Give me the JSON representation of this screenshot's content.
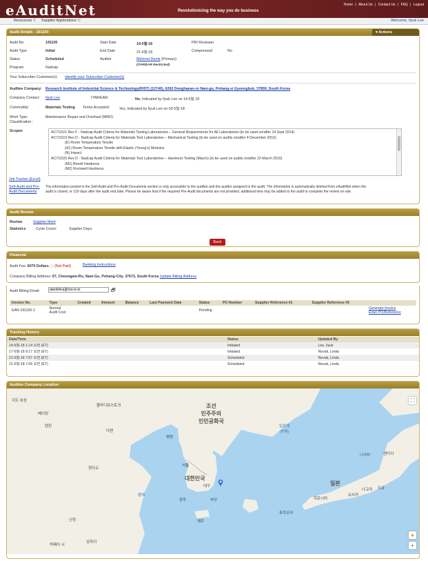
{
  "header": {
    "logo": "eAuditNet",
    "tagline": "Revolutionizing the way you do business",
    "links": [
      "Home",
      "About Us",
      "Contact Us",
      "FAQ",
      "Logout"
    ],
    "separator": "|"
  },
  "nav": {
    "menu1": "Resources",
    "menu2": "Supplier Applications",
    "arrow": "▽",
    "welcome": "Welcome, Ilyuk Lee"
  },
  "audit": {
    "title": "Audit Details - 191100",
    "actions": "Actions",
    "l_no": "Audit No.",
    "v_no": "191100",
    "l_type": "Audit Type",
    "v_type": "Initial",
    "l_status": "Status",
    "v_status": "Scheduled",
    "l_program": "Program",
    "v_program": "Nadcap",
    "l_start": "Start Date",
    "v_start": "19-5월-18",
    "l_end": "End Date",
    "v_end": "21-5월-18",
    "l_auditor": "Auditor",
    "v_auditor": "Mehmet Demir",
    "v_primary": "(Primary)",
    "v_itar": "(ITAR/EAR Restricted)",
    "l_pri": "PRI Reviewer",
    "l_comp": "Compressed",
    "v_comp": "No",
    "l_subcust": "Your Subscriber Customer(s):",
    "v_subcust": "Identify your Subscriber Customer(s)",
    "l_company": "Auditee Company:",
    "v_company": "Research Institute of Industrial Science & Technology(RIST) (12740), 6262 Donghaean-ro Nam-gu, Pohang-si Gyeongbuk, 37859, South Korea",
    "l_contact": "Company Contact:",
    "v_contact": "Ilyuk Lee",
    "l_itar": "ITAR/EAR:",
    "v_itar_no": "No",
    "v_itar_rest": ", Indicated by Ilyuk Lee on 14-5월-18",
    "l_commodity": "Commodity:",
    "v_commodity": "Materials Testing",
    "l_terms": "Terms Accepted:",
    "v_terms": "Yes, Indicated by Ilyuk Lee on 03-5월-18",
    "l_worktype": "Work Type:",
    "l_class": "Classification :",
    "v_worktype": "Maintenance Repair and Overhaul (MRO)",
    "l_scopes": "Scopes",
    "scopes": [
      {
        "t": "AC7101/1 Rev F - Nadcap Audit Criteria for Materials Testing Laboratories – General Requirements for All Laboratories (to be used on/after 14 Sept 2014)",
        "i": false
      },
      {
        "t": "AC7101/3 Rev D - Nadcap Audit Criteria for Materials Test Laboratories – Mechanical Testing (to be used on audits on/after 4 December 2016)",
        "i": false
      },
      {
        "t": "(E) Room Temperature Tensile",
        "i": true
      },
      {
        "t": "(A1) Room Temperature Tensile with Elastic (Young's) Modulus",
        "i": true
      },
      {
        "t": "(N) Impact",
        "i": true
      },
      {
        "t": "AC7101/5 Rev D - Nadcap Audit Criteria for Materials Test Laboratories – Hardness Testing (Macro) (to be used on audits on/after 22 March 2015)",
        "i": false
      },
      {
        "t": "(M1) Brinell Hardness",
        "i": true
      },
      {
        "t": "(M2) Rockwell Hardness",
        "i": true
      }
    ],
    "l_jobtracker": "Job Tracker (Excel)",
    "l_selfaudit1": "Self-Audit and Pre-",
    "l_selfaudit2": "Audit Documents",
    "notice1": "The information posted in the Self-Audit and Pre-Audit Documents section is only accessible to the auditee and the auditor assigned to the audit. The information is automatically deleted from eAuditNet when the",
    "notice2": "audit is closed, or 120 days after the audit end date. Please be aware that if the required Pre-Audit documents are not provided, additional time may be added to the audit to complete the review on-site."
  },
  "review": {
    "title": "Audit Review",
    "l_review": "Review",
    "v_review": "Supplier Merit",
    "l_stats": "Statistics",
    "l_cycle": "Cycle Count:",
    "l_days": "Supplier Days:",
    "back": "Back"
  },
  "financial": {
    "title": "Financial",
    "l_fee": "Audit Fee:",
    "v_fee": "6070 Dollars",
    "v_paid": "(Not Paid)",
    "v_bank": "Banking Instructions",
    "l_addr": "Company Billing Address:",
    "v_addr": "67, Cheongam-Ro, Nam-Gu, Pohang-City, 37673, South Korea",
    "v_update": "Update Billing Address",
    "l_email": "Audit Billing Email:",
    "v_email": "dandelica@rist.re.kr",
    "headers": [
      "Invoice No.",
      "Type",
      "Created",
      "Amount",
      "Balance",
      "Last Payment Date",
      "Status",
      "PO Number",
      "Supplier Reference #1",
      "Supplier Reference #2"
    ],
    "inv_no": "EAN-191100-1",
    "inv_type1": "Normal",
    "inv_type2": "Audit Cost",
    "inv_status": "Pending",
    "gen": "Generate Invoice",
    "enter_po": "Enter PO/Reference"
  },
  "tracking": {
    "title": "Tracking History",
    "headers": [
      "Date/Time",
      "Status",
      "Updated By"
    ],
    "rows": [
      {
        "d": "14-5월-18 1:14 오전 (ET)",
        "s": "Initiated",
        "u": "Lee, Ilyuk"
      },
      {
        "d": "17-5월-18 9:17 오전 (ET)",
        "s": "Initiated",
        "u": "Novak, Linda"
      },
      {
        "d": "21-5월-18 7:07 오전 (ET)",
        "s": "Scheduled",
        "u": "Novak, Linda"
      },
      {
        "d": "21-5월-18 7:06 오전 (ET)",
        "s": "Scheduled",
        "u": "Novak, Linda"
      }
    ]
  },
  "location": {
    "title": "Auditee Company Location",
    "maptype1": "지도",
    "maptype2": "위성",
    "labels": {
      "nk": "조선\n민주주의\n인민공화국",
      "sk": "대한민국",
      "seoul": "서울",
      "busan": "부산",
      "daegu": "대구",
      "gwangju": "광주",
      "jeju": "제주",
      "japan": "일본",
      "tokyo": "도쿄",
      "osaka": "오사카",
      "beijing": "베이징",
      "tianjin": "텐진",
      "dalian": "다롄",
      "qingdao": "칭다오",
      "shanghai": "상하이",
      "pyongyang": "평양",
      "fukuoka": "후쿠오카",
      "hiroshima": "히로시마",
      "nagoya": "나고야",
      "sendai": "센다이",
      "niigata": "니가타",
      "vladivostok": "블라디보스토크",
      "eastsea": "일본해\n(동해)",
      "yellowsea": "황해",
      "nanjing": "난징",
      "hefei": "허페이 시"
    },
    "zoomin": "+",
    "fullscreen": "⛶"
  }
}
